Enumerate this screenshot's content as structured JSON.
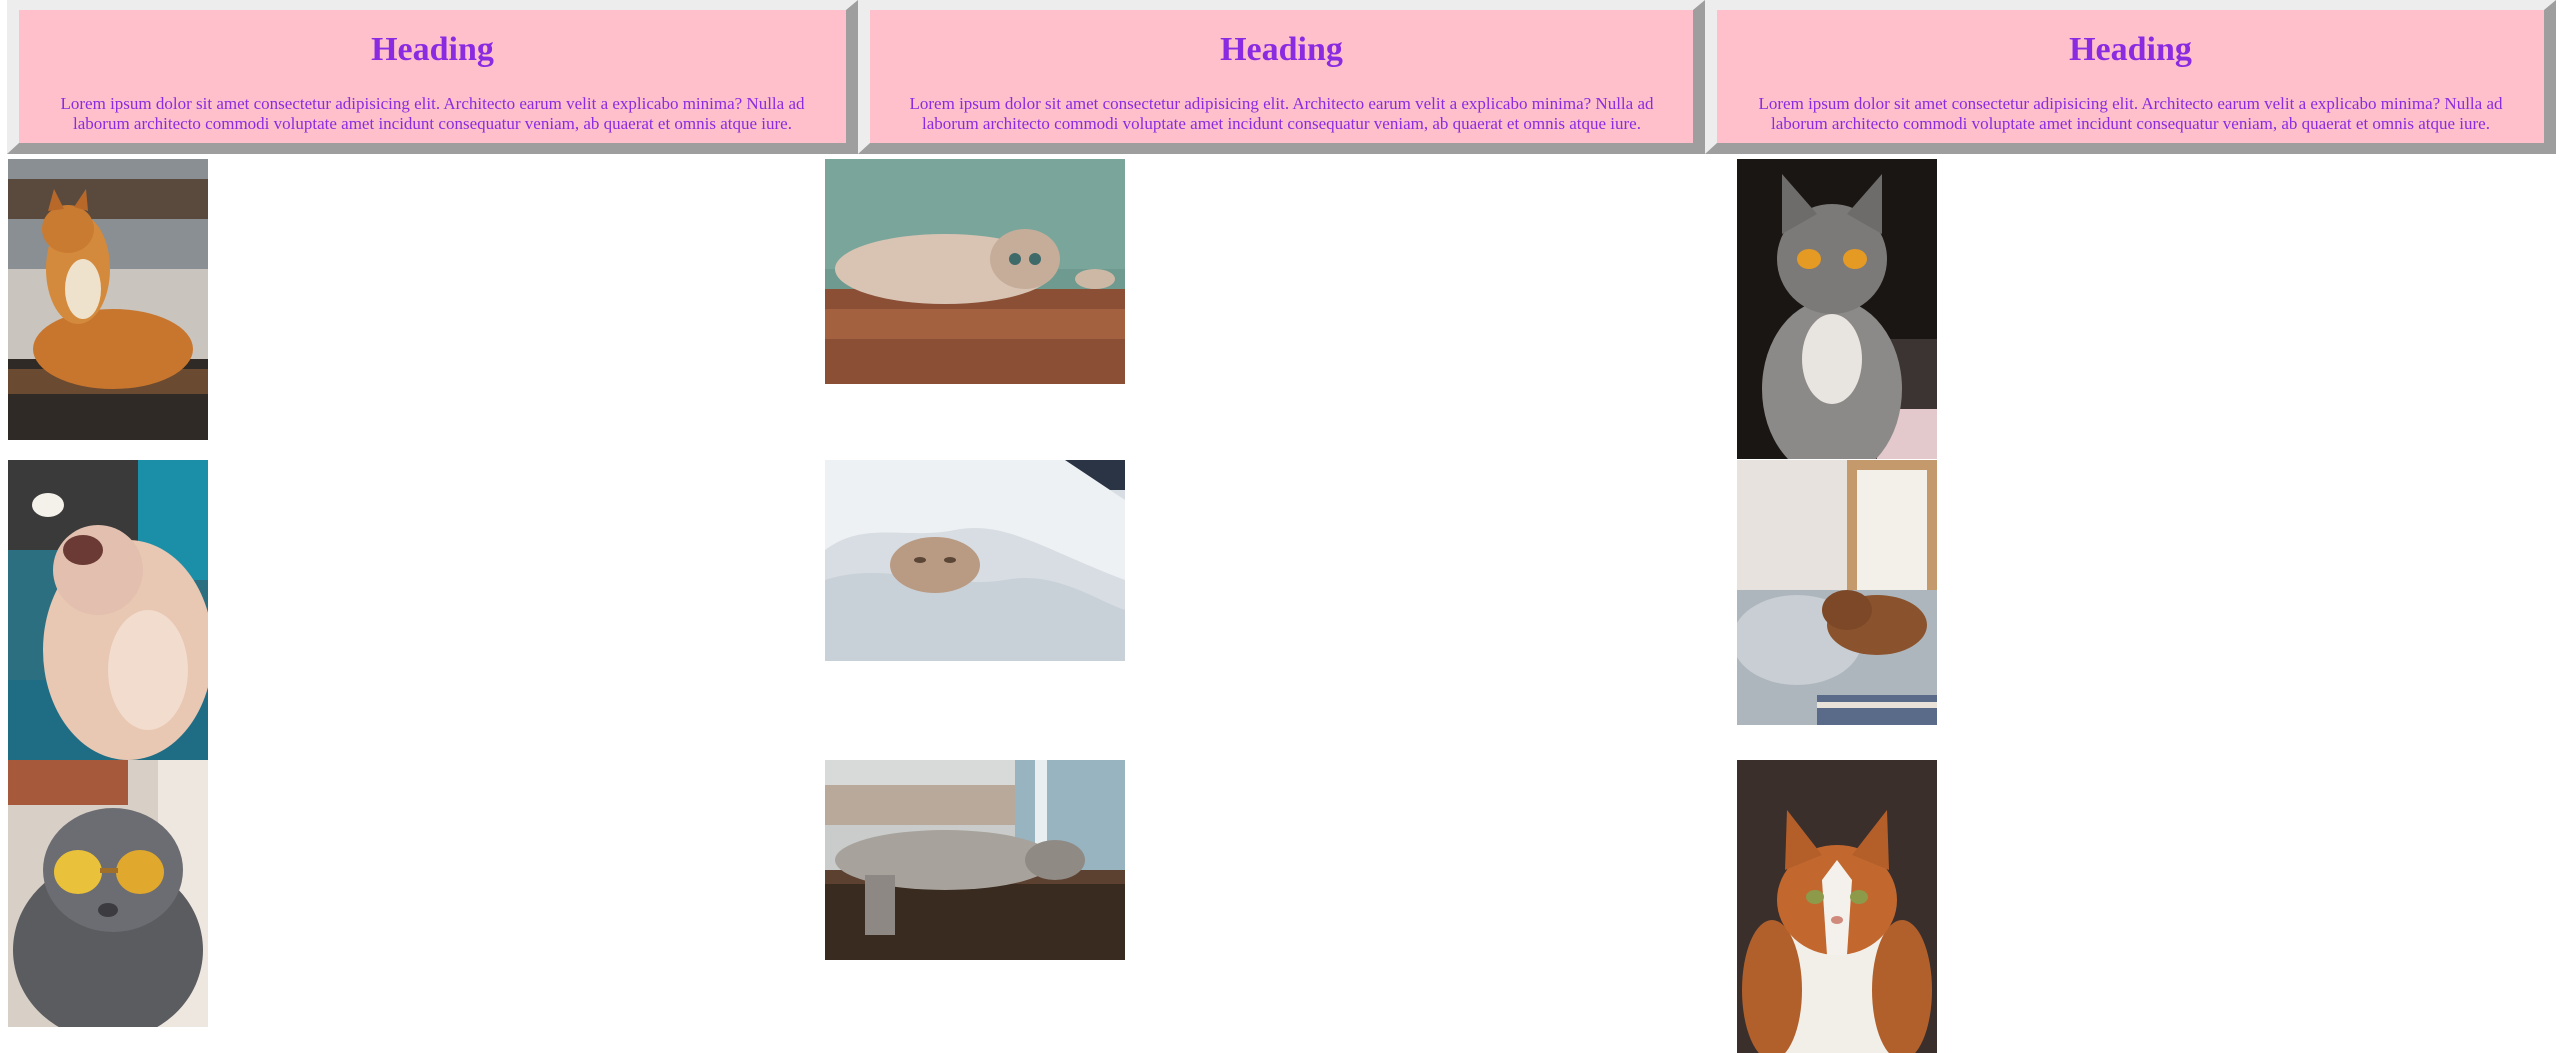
{
  "cards": [
    {
      "heading": "Heading",
      "text": "Lorem ipsum dolor sit amet consectetur adipisicing elit. Architecto earum velit a explicabo minima? Nulla ad laborum architecto commodi voluptate amet incidunt consequatur veniam, ab quaerat et omnis atque iure."
    },
    {
      "heading": "Heading",
      "text": "Lorem ipsum dolor sit amet consectetur adipisicing elit. Architecto earum velit a explicabo minima? Nulla ad laborum architecto commodi voluptate amet incidunt consequatur veniam, ab quaerat et omnis atque iure."
    },
    {
      "heading": "Heading",
      "text": "Lorem ipsum dolor sit amet consectetur adipisicing elit. Architecto earum velit a explicabo minima? Nulla ad laborum architecto commodi voluptate amet incidunt consequatur veniam, ab quaerat et omnis atque iure."
    }
  ],
  "colors": {
    "card_background": "#ffc0cb",
    "heading_text": "#8a2be2",
    "border_light": "#ededed",
    "border_dark": "#9e9e9e"
  }
}
